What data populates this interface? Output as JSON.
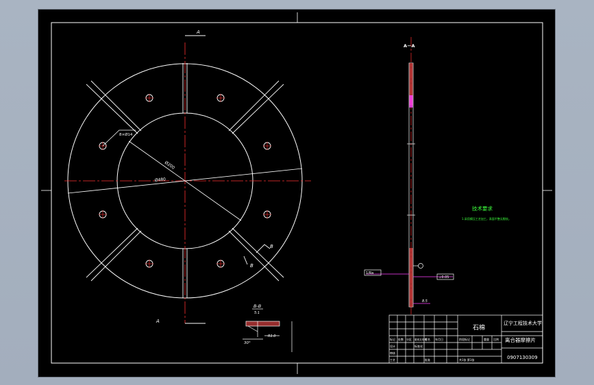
{
  "colors": {
    "background": "#a8b3c1",
    "sheet": "#000000",
    "line": "#ffffff",
    "centerline": "#ff3030",
    "dimension": "#ff40ff",
    "note_text": "#3dff3d",
    "hatch": "#c83c3c"
  },
  "section_marks": {
    "a_top": "A",
    "a_bottom": "A",
    "b_upper": "B",
    "b_lower": "B"
  },
  "main_view": {
    "outer_dim": "Ø480",
    "inner_dim": "Ø200",
    "hole_dim": "8×Ø14"
  },
  "section_view": {
    "title": "A－A",
    "callout_left": "1/Ra",
    "callout_right": "⊥0.05",
    "thickness": "8.5"
  },
  "detail_view": {
    "title": "B-B",
    "scale": "5:1",
    "angle": "30°",
    "dim": "R1.0"
  },
  "tech_requirements": {
    "title": "技术要求",
    "line1": "1.采用模压工艺加工，表面平整无裂纹。"
  },
  "title_block": {
    "material": "石棉",
    "school": "辽宁工程技术大学",
    "part_name": "离合器摩擦片",
    "drawing_no": "0907130309",
    "col_stage": "阶段标记",
    "col_weight": "重量",
    "col_scale": "比例",
    "sheet_info": "共1张 第1张",
    "row_labels": [
      "标记",
      "设计",
      "审核",
      "工艺"
    ],
    "row_cols": [
      "处数",
      "分区",
      "更改文件号",
      "签名",
      "年月日"
    ],
    "std_label": "标准化",
    "approve_label": "批准"
  }
}
